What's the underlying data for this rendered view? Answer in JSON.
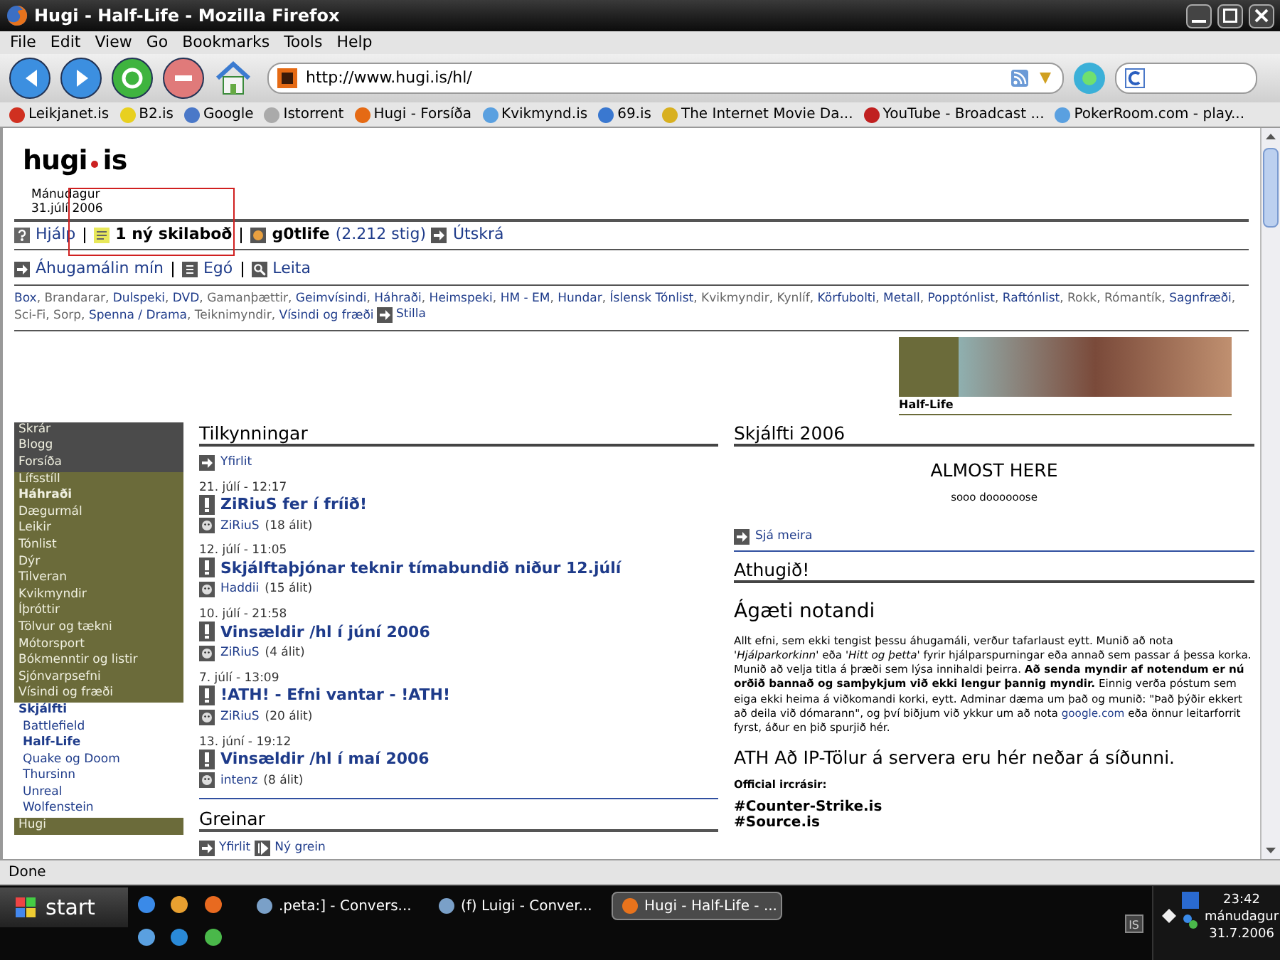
{
  "window": {
    "title": "Hugi - Half-Life - Mozilla Firefox"
  },
  "menu": [
    "File",
    "Edit",
    "View",
    "Go",
    "Bookmarks",
    "Tools",
    "Help"
  ],
  "address_bar": {
    "value": "http://www.hugi.is/hl/"
  },
  "bookmarks": [
    "Leikjanet.is",
    "B2.is",
    "Google",
    "Istorrent",
    "Hugi - Forsíða",
    "Kvikmynd.is",
    "69.is",
    "The Internet Movie Da...",
    "YouTube - Broadcast ...",
    "PokerRoom.com - play..."
  ],
  "page": {
    "logo": {
      "left": "hugi",
      "right": "is"
    },
    "date": {
      "weekday": "Mánudagur",
      "date": "31.júlí 2006"
    },
    "user_bar": {
      "help": "Hjálp",
      "messages": "1 ný skilaboð",
      "user": "g0tlife",
      "points": "(2.212 stig)",
      "logout": "Útskrá"
    },
    "nav_bar": [
      "Áhugamálin mín",
      "Egó",
      "Leita"
    ],
    "categories": [
      {
        "label": "Box",
        "highlighted": true
      },
      {
        "label": "Brandarar",
        "highlighted": false
      },
      {
        "label": "Dulspeki",
        "highlighted": true
      },
      {
        "label": "DVD",
        "highlighted": true
      },
      {
        "label": "Gamanþættir",
        "highlighted": false
      },
      {
        "label": "Geimvísindi",
        "highlighted": true
      },
      {
        "label": "Háhraði",
        "highlighted": true
      },
      {
        "label": "Heimspeki",
        "highlighted": true
      },
      {
        "label": "HM - EM",
        "highlighted": true
      },
      {
        "label": "Hundar",
        "highlighted": true
      },
      {
        "label": "Íslensk Tónlist",
        "highlighted": true
      },
      {
        "label": "Kvikmyndir",
        "highlighted": false
      },
      {
        "label": "Kynlíf",
        "highlighted": false
      },
      {
        "label": "Körfubolti",
        "highlighted": true
      },
      {
        "label": "Metall",
        "highlighted": true
      },
      {
        "label": "Popptónlist",
        "highlighted": true
      },
      {
        "label": "Raftónlist",
        "highlighted": true
      },
      {
        "label": "Rokk",
        "highlighted": false
      },
      {
        "label": "Rómantík",
        "highlighted": false
      },
      {
        "label": "Sagnfræði",
        "highlighted": true
      },
      {
        "label": "Sci-Fi",
        "highlighted": false
      },
      {
        "label": "Sorp",
        "highlighted": false
      },
      {
        "label": "Spenna / Drama",
        "highlighted": true
      },
      {
        "label": "Teiknimyndir",
        "highlighted": false
      },
      {
        "label": "Vísindi og fræði",
        "highlighted": true
      }
    ],
    "categories_separator": ",",
    "categories_settings": "Stilla",
    "banner": {
      "caption": "Half-Life"
    },
    "sidebar": [
      {
        "kind": "dark",
        "items": [
          {
            "label": "Skrár",
            "selected": false
          },
          {
            "label": "Blogg",
            "selected": false
          },
          {
            "label": "Forsíða",
            "selected": false
          }
        ]
      },
      {
        "kind": "olive",
        "items": [
          {
            "label": "Lífsstíll",
            "selected": false
          },
          {
            "label": "Háhraði",
            "selected": true
          },
          {
            "label": "Dægurmál",
            "selected": false
          },
          {
            "label": "Leikir",
            "selected": false
          },
          {
            "label": "Tónlist",
            "selected": false
          },
          {
            "label": "Dýr",
            "selected": false
          },
          {
            "label": "Tilveran",
            "selected": false
          },
          {
            "label": "Kvikmyndir",
            "selected": false
          },
          {
            "label": "Íþróttir",
            "selected": false
          },
          {
            "label": "Tölvur og tækni",
            "selected": false
          },
          {
            "label": "Mótorsport",
            "selected": false
          },
          {
            "label": "Bókmenntir og listir",
            "selected": false
          },
          {
            "label": "Sjónvarpsefni",
            "selected": false
          },
          {
            "label": "Vísindi og fræði",
            "selected": false
          }
        ]
      },
      {
        "kind": "white",
        "items": [
          {
            "label": "Skjálfti",
            "selected": true,
            "children": [
              {
                "label": "Battlefield",
                "selected": false
              },
              {
                "label": "Half-Life",
                "selected": true
              },
              {
                "label": "Quake og Doom",
                "selected": false
              },
              {
                "label": "Thursinn",
                "selected": false
              },
              {
                "label": "Unreal",
                "selected": false
              },
              {
                "label": "Wolfenstein",
                "selected": false
              }
            ]
          }
        ]
      },
      {
        "kind": "olive",
        "items": [
          {
            "label": "Hugi",
            "selected": false
          }
        ]
      }
    ],
    "announcements": {
      "title": "Tilkynningar",
      "overview": "Yfirlit",
      "items": [
        {
          "date": "21. júlí - 12:17",
          "title": "ZiRiuS fer í fríið!",
          "author": "ZiRiuS",
          "comments": "(18 álit)"
        },
        {
          "date": "12. júlí - 11:05",
          "title": "Skjálftaþjónar teknir tímabundið niður 12.júlí",
          "author": "Haddii",
          "comments": "(15 álit)"
        },
        {
          "date": "10. júlí - 21:58",
          "title": "Vinsældir /hl í júní 2006",
          "author": "ZiRiuS",
          "comments": "(4 álit)"
        },
        {
          "date": "7. júlí - 13:09",
          "title": "!ATH! - Efni vantar - !ATH!",
          "author": "ZiRiuS",
          "comments": "(20 álit)"
        },
        {
          "date": "13. júní - 19:12",
          "title": "Vinsældir /hl í maí 2006",
          "author": "intenz",
          "comments": "(8 álit)"
        }
      ]
    },
    "articles": {
      "title": "Greinar",
      "overview": "Yfirlit",
      "new": "Ný grein"
    },
    "skjalfti": {
      "title": "Skjálfti 2006",
      "headline": "ALMOST HERE",
      "subline": "sooo doooooose",
      "more": "Sjá meira"
    },
    "notice": {
      "title": "Athugið!",
      "greeting": "Ágæti notandi",
      "paragraph_before": "Allt efni, sem ekki tengist þessu áhugamáli, verður tafarlaust eytt. Munið að nota *'Hjálparkorkinn'* eða *'Hitt og þetta'* fyrir hjálparspurningar eða annað sem passar á þessa korka. Munið að velja titla á þræði sem lýsa innihaldi þeirra. **Að senda myndir af notendum er nú orðið bannað og samþykjum við ekki lengur þannig myndir.** Einnig verða póstum sem eiga ekki heima á viðkomandi korki, eytt. Adminar dæma um það og munið: \"Það þýðir ekkert að deila við dómarann\", og því biðjum við ykkur um að nota",
      "paragraph_link": "google.com",
      "paragraph_after": "eða önnur leitarforrit fyrst, áður en þið spurjið hér.",
      "ip_heading": "ATH Að IP-Tölur á servera eru hér neðar á síðunni.",
      "irc_label": "Official ircrásir:",
      "irc_channels": [
        "#Counter-Strike.is",
        "#Source.is"
      ]
    }
  },
  "status_bar": "Done",
  "taskbar": {
    "start": "start",
    "tasks": [
      {
        "label": ".peta:] - Convers...",
        "selected": false
      },
      {
        "label": "(f) Luigi - Conver...",
        "selected": false
      },
      {
        "label": "Hugi - Half-Life - ...",
        "selected": true
      }
    ],
    "language": "IS",
    "time": "23:42",
    "weekday": "mánudagur",
    "date": "31.7.2006"
  }
}
